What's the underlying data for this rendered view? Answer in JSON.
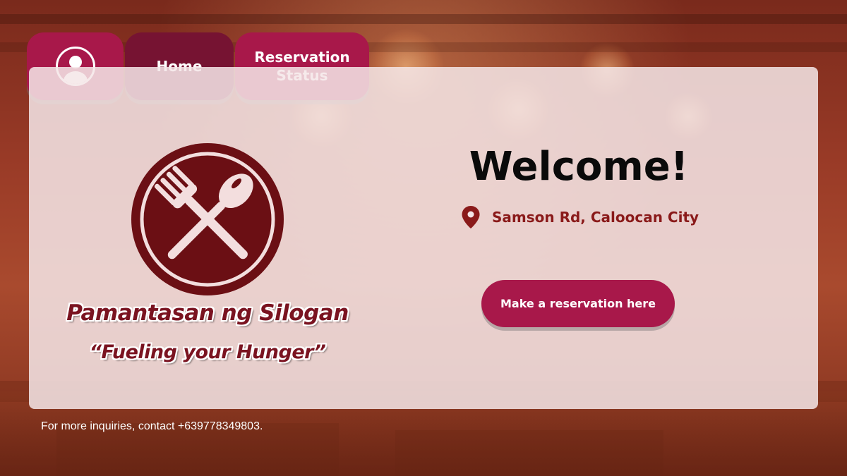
{
  "nav": {
    "home_label": "Home",
    "status_label": "Reservation Status"
  },
  "brand": {
    "name": "Pamantasan ng Silogan",
    "tagline": "“Fueling your Hunger”"
  },
  "hero": {
    "welcome": "Welcome!",
    "location": "Samson Rd, Caloocan City",
    "cta_label": "Make a reservation here"
  },
  "footer": {
    "contact": "For more inquiries, contact +639778349803."
  },
  "colors": {
    "primary": "#a8184a",
    "primary_dark": "#761332",
    "logo": "#6b0f14",
    "text_accent": "#8a1a1a"
  }
}
